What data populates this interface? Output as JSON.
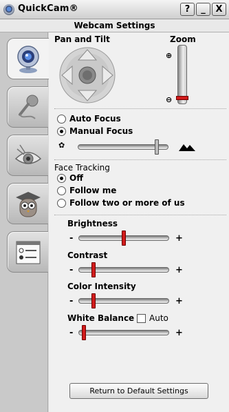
{
  "window": {
    "title": "QuickCam®",
    "help_label": "?",
    "minimize_label": "_",
    "close_label": "X"
  },
  "subtitle": "Webcam Settings",
  "sidebar": {
    "tabs": [
      {
        "icon": "webcam-icon",
        "active": true
      },
      {
        "icon": "microphone-icon",
        "active": false
      },
      {
        "icon": "eye-icon",
        "active": false
      },
      {
        "icon": "owl-graduate-icon",
        "active": false
      },
      {
        "icon": "options-list-icon",
        "active": false
      }
    ]
  },
  "pan_tilt": {
    "label": "Pan and Tilt"
  },
  "zoom": {
    "label": "Zoom",
    "level": 0.1
  },
  "focus": {
    "options": [
      {
        "label": "Auto Focus",
        "checked": false
      },
      {
        "label": "Manual Focus",
        "checked": true
      }
    ],
    "level": 0.87
  },
  "face_tracking": {
    "label": "Face Tracking",
    "options": [
      {
        "label": "Off",
        "checked": true
      },
      {
        "label": "Follow me",
        "checked": false
      },
      {
        "label": "Follow two or more of us",
        "checked": false
      }
    ]
  },
  "adjustments": {
    "brightness": {
      "label": "Brightness",
      "value": 0.5
    },
    "contrast": {
      "label": "Contrast",
      "value": 0.17
    },
    "color_intensity": {
      "label": "Color Intensity",
      "value": 0.17
    },
    "white_balance": {
      "label": "White Balance",
      "value": 0.06,
      "auto_label": "Auto",
      "auto_checked": false
    },
    "minus": "-",
    "plus": "+"
  },
  "default_button": "Return to Default Settings",
  "colors": {
    "slider_thumb": "#d11b1b",
    "window_bg": "#f0f0f0",
    "sidebar_bg": "#c9c9c9"
  }
}
